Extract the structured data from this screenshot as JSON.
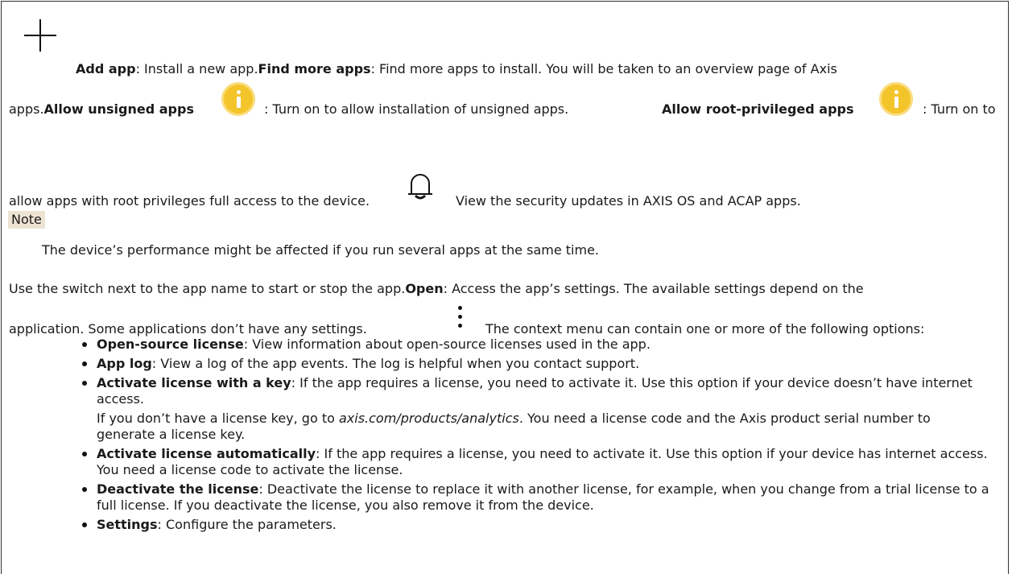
{
  "apps_panel": {
    "add_app_label": "Add app",
    "add_app_desc": ": Install a new app.",
    "find_more_label": "Find more apps",
    "find_more_desc": ": Find more apps to install. You will be taken to an overview page of Axis",
    "find_more_desc_cont": "apps.",
    "allow_unsigned_label": "Allow unsigned apps",
    "allow_unsigned_desc": ": Turn on to allow installation of unsigned apps.",
    "allow_root_label": "Allow root-privileged apps",
    "allow_root_desc": ": Turn on to",
    "allow_root_desc_cont": "allow apps with root privileges full access to the device.",
    "security_desc": "View the security updates in AXIS OS and ACAP apps."
  },
  "note": {
    "label": "Note",
    "text": "The device’s performance might be affected if you run several apps at the same time."
  },
  "app_row": {
    "switch_desc": "Use the switch next to the app name to start or stop the app.",
    "open_label": "Open",
    "open_desc": ": Access the app’s settings. The available settings depend on the",
    "open_desc_cont": "application. Some applications don’t have any settings.",
    "context_desc": "The context menu can contain one or more of the following options:"
  },
  "context_options": [
    {
      "label": "Open-source license",
      "desc": ": View information about open-source licenses used in the app."
    },
    {
      "label": "App log",
      "desc": ": View a log of the app events. The log is helpful when you contact support."
    },
    {
      "label": "Activate license with a key",
      "desc": ": If the app requires a license, you need to activate it. Use this option if your device doesn’t have internet access.",
      "extra_pre": "If you don’t have a license key, go to ",
      "extra_link": "axis.com/products/analytics",
      "extra_post": ". You need a license code and the Axis product serial number to generate a license key."
    },
    {
      "label": "Activate license automatically",
      "desc": ": If the app requires a license, you need to activate it. Use this option if your device has internet access. You need a license code to activate the license."
    },
    {
      "label": "Deactivate the license",
      "desc": ": Deactivate the license to replace it with another license, for example, when you change from a trial license to a full license. If you deactivate the license, you also remove it from the device."
    },
    {
      "label": "Settings",
      "desc": ": Configure the parameters."
    }
  ]
}
